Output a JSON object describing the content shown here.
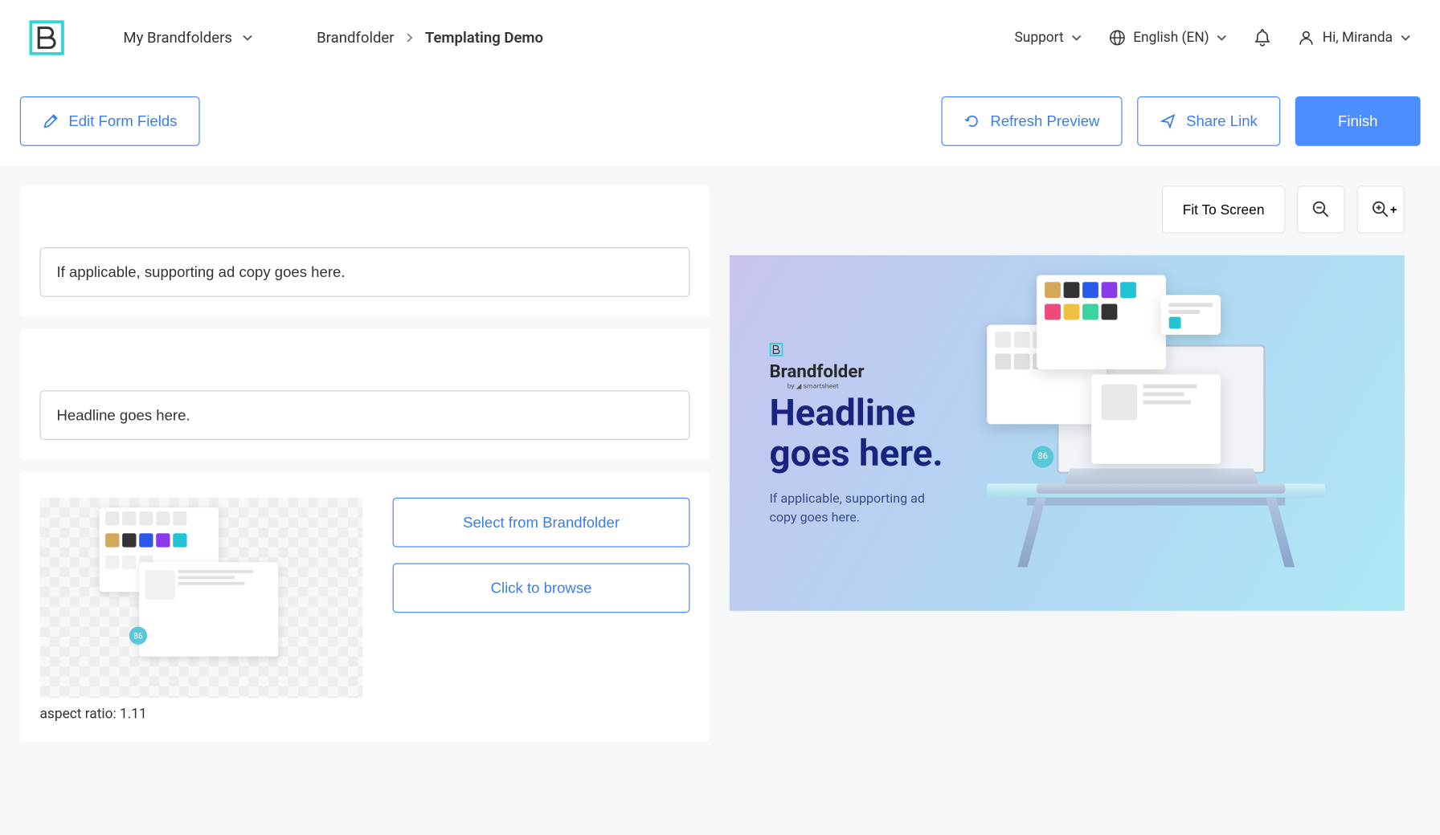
{
  "header": {
    "brandfolders_dropdown": "My Brandfolders",
    "breadcrumb": {
      "parent": "Brandfolder",
      "current": "Templating Demo"
    },
    "support": "Support",
    "language": "English (EN)",
    "user_greeting": "Hi, Miranda"
  },
  "actions": {
    "edit_form_fields": "Edit Form Fields",
    "refresh_preview": "Refresh Preview",
    "share_link": "Share Link",
    "finish": "Finish"
  },
  "form": {
    "supporting_copy_value": "If applicable, supporting ad copy goes here.",
    "headline_value": "Headline goes here.",
    "aspect_ratio": "aspect ratio: 1.11",
    "select_from_brandfolder": "Select from Brandfolder",
    "click_to_browse": "Click to browse"
  },
  "preview_controls": {
    "fit_to_screen": "Fit To Screen"
  },
  "preview": {
    "brand_name": "Brandfolder",
    "brand_sub": "by ◢ smartsheet",
    "headline_line1": "Headline",
    "headline_line2": "goes here.",
    "subcopy": "If applicable, supporting ad copy goes here.",
    "badge_value": "86"
  },
  "mini_preview": {
    "badge_value": "86"
  }
}
